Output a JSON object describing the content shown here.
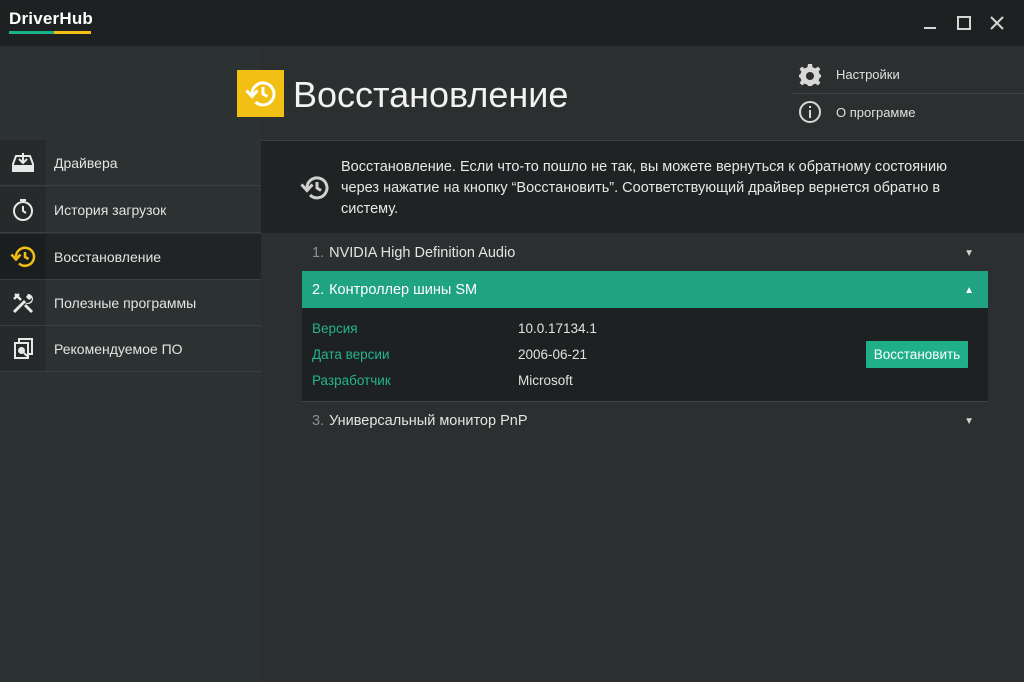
{
  "app": {
    "name": "DriverHub",
    "window_controls": {
      "minimize": "—",
      "maximize": "☐",
      "close": "✕"
    }
  },
  "sidebar": {
    "items": [
      {
        "label": "Драйвера",
        "icon": "download-drive-icon"
      },
      {
        "label": "История загрузок",
        "icon": "clock-icon"
      },
      {
        "label": "Восстановление",
        "icon": "restore-icon",
        "active": true
      },
      {
        "label": "Полезные программы",
        "icon": "tools-icon"
      },
      {
        "label": "Рекомендуемое ПО",
        "icon": "recommended-apps-icon"
      }
    ]
  },
  "header": {
    "title": "Восстановление",
    "menu": [
      {
        "label": "Настройки",
        "icon": "gear-icon"
      },
      {
        "label": "О программе",
        "icon": "info-icon"
      }
    ]
  },
  "info": {
    "text": "Восстановление. Если что-то пошло не так, вы можете вернуться к обратному состоянию через нажатие на кнопку “Восстановить”. Соответствующий драйвер вернется обратно в систему."
  },
  "drivers": [
    {
      "num": "1.",
      "name": "NVIDIA High Definition Audio"
    },
    {
      "num": "2.",
      "name": "Контроллер шины SM",
      "props": [
        {
          "label": "Версия",
          "value": "10.0.17134.1"
        },
        {
          "label": "Дата версии",
          "value": "2006-06-21"
        },
        {
          "label": "Разработчик",
          "value": "Microsoft"
        }
      ],
      "restore_label": "Восстановить"
    },
    {
      "num": "3.",
      "name": "Универсальный монитор PnP"
    }
  ],
  "colors": {
    "accent": "#1fa383",
    "brand_yellow": "#f2c014",
    "label_green": "#24b38f"
  }
}
